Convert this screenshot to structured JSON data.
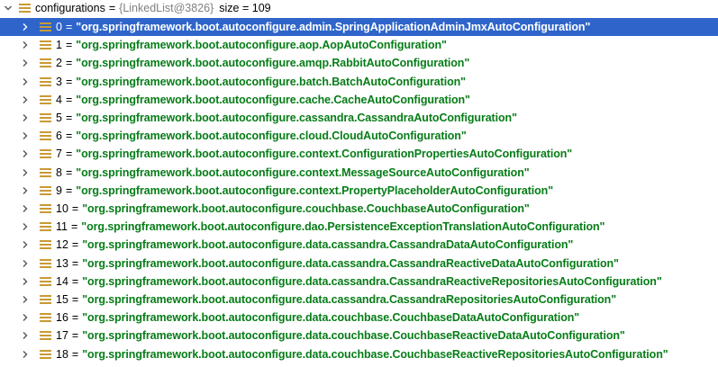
{
  "root": {
    "name": "configurations",
    "equals": "=",
    "type": "{LinkedList@3826}",
    "size_text": "size = 109"
  },
  "items": [
    {
      "index": "0",
      "value": "\"org.springframework.boot.autoconfigure.admin.SpringApplicationAdminJmxAutoConfiguration\""
    },
    {
      "index": "1",
      "value": "\"org.springframework.boot.autoconfigure.aop.AopAutoConfiguration\""
    },
    {
      "index": "2",
      "value": "\"org.springframework.boot.autoconfigure.amqp.RabbitAutoConfiguration\""
    },
    {
      "index": "3",
      "value": "\"org.springframework.boot.autoconfigure.batch.BatchAutoConfiguration\""
    },
    {
      "index": "4",
      "value": "\"org.springframework.boot.autoconfigure.cache.CacheAutoConfiguration\""
    },
    {
      "index": "5",
      "value": "\"org.springframework.boot.autoconfigure.cassandra.CassandraAutoConfiguration\""
    },
    {
      "index": "6",
      "value": "\"org.springframework.boot.autoconfigure.cloud.CloudAutoConfiguration\""
    },
    {
      "index": "7",
      "value": "\"org.springframework.boot.autoconfigure.context.ConfigurationPropertiesAutoConfiguration\""
    },
    {
      "index": "8",
      "value": "\"org.springframework.boot.autoconfigure.context.MessageSourceAutoConfiguration\""
    },
    {
      "index": "9",
      "value": "\"org.springframework.boot.autoconfigure.context.PropertyPlaceholderAutoConfiguration\""
    },
    {
      "index": "10",
      "value": "\"org.springframework.boot.autoconfigure.couchbase.CouchbaseAutoConfiguration\""
    },
    {
      "index": "11",
      "value": "\"org.springframework.boot.autoconfigure.dao.PersistenceExceptionTranslationAutoConfiguration\""
    },
    {
      "index": "12",
      "value": "\"org.springframework.boot.autoconfigure.data.cassandra.CassandraDataAutoConfiguration\""
    },
    {
      "index": "13",
      "value": "\"org.springframework.boot.autoconfigure.data.cassandra.CassandraReactiveDataAutoConfiguration\""
    },
    {
      "index": "14",
      "value": "\"org.springframework.boot.autoconfigure.data.cassandra.CassandraReactiveRepositoriesAutoConfiguration\""
    },
    {
      "index": "15",
      "value": "\"org.springframework.boot.autoconfigure.data.cassandra.CassandraRepositoriesAutoConfiguration\""
    },
    {
      "index": "16",
      "value": "\"org.springframework.boot.autoconfigure.data.couchbase.CouchbaseDataAutoConfiguration\""
    },
    {
      "index": "17",
      "value": "\"org.springframework.boot.autoconfigure.data.couchbase.CouchbaseReactiveDataAutoConfiguration\""
    },
    {
      "index": "18",
      "value": "\"org.springframework.boot.autoconfigure.data.couchbase.CouchbaseReactiveRepositoriesAutoConfiguration\""
    }
  ],
  "selected_index": 0,
  "colors": {
    "selection": "#2f65ca",
    "string_value": "#067d17",
    "type_text": "#808080",
    "field_icon": "#c99a35"
  },
  "icons": {
    "expand_arrow": "chevron-right-icon",
    "collapse_arrow": "chevron-down-icon",
    "field": "field-list-icon"
  }
}
